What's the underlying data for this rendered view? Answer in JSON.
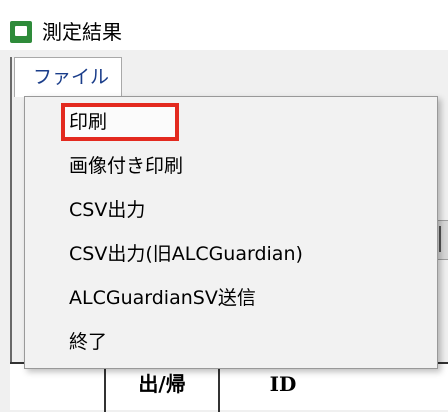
{
  "window": {
    "title": "測定結果"
  },
  "menubar": {
    "file_label": "ファイル"
  },
  "file_menu": {
    "items": [
      {
        "label": "印刷",
        "selected": true
      },
      {
        "label": "画像付き印刷"
      },
      {
        "label": "CSV出力"
      },
      {
        "label": "CSV出力(旧ALCGuardian)"
      },
      {
        "label": "ALCGuardianSV送信"
      },
      {
        "label": "終了"
      }
    ],
    "highlight_color": "#e32a1f"
  },
  "grid": {
    "headers": [
      "出/帰",
      "ID"
    ]
  },
  "icons": {
    "app": "app-icon"
  }
}
